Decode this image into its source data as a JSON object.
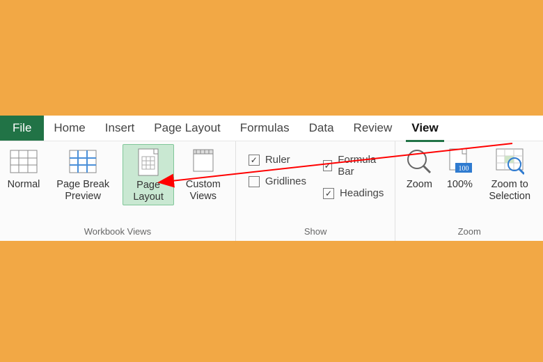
{
  "tabs": {
    "file": "File",
    "home": "Home",
    "insert": "Insert",
    "page_layout": "Page Layout",
    "formulas": "Formulas",
    "data": "Data",
    "review": "Review",
    "view": "View"
  },
  "groups": {
    "workbook_views": {
      "label": "Workbook Views",
      "normal": "Normal",
      "page_break": "Page Break Preview",
      "page_layout": "Page Layout",
      "custom": "Custom Views"
    },
    "show": {
      "label": "Show",
      "ruler": "Ruler",
      "gridlines": "Gridlines",
      "formula_bar": "Formula Bar",
      "headings": "Headings"
    },
    "zoom": {
      "label": "Zoom",
      "zoom": "Zoom",
      "hundred": "100%",
      "to_selection": "Zoom to Selection",
      "hundred_badge": "100"
    }
  },
  "state": {
    "active_tab": "view",
    "selected_view": "page_layout",
    "ruler_checked": true,
    "gridlines_checked": false,
    "formula_bar_checked": true,
    "headings_checked": true
  },
  "colors": {
    "accent": "#217346",
    "highlight": "#c9e8d2",
    "bg": "#f2a845",
    "annotation": "#ff0000"
  }
}
